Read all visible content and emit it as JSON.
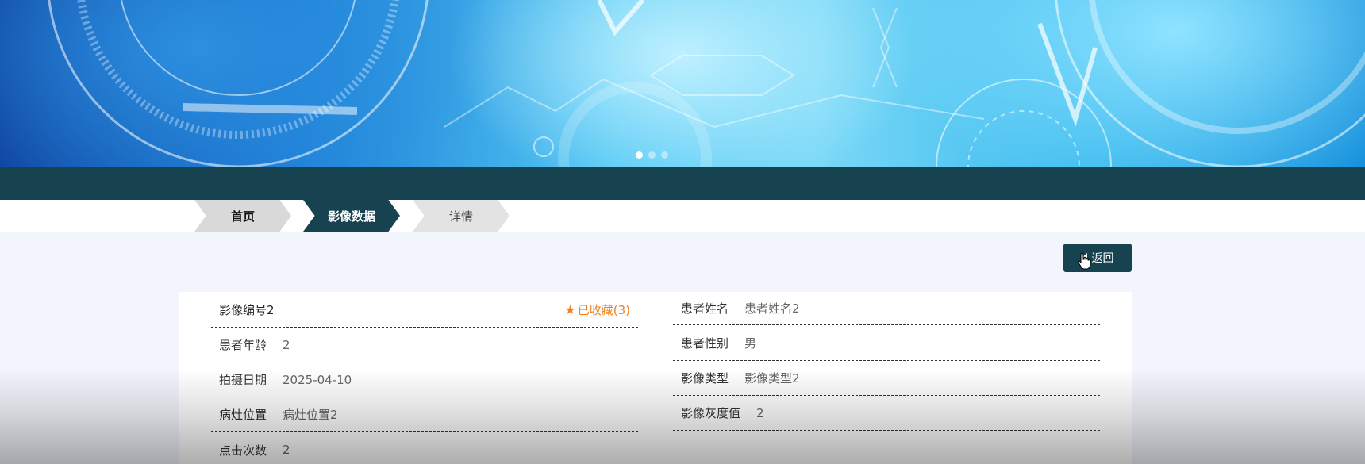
{
  "banner": {
    "carousel_active_index": 0,
    "carousel_count": 3
  },
  "breadcrumb": {
    "home": "首页",
    "section": "影像数据",
    "current": "详情"
  },
  "actions": {
    "back_label": "返回"
  },
  "detail": {
    "title": "影像编号2",
    "favorite_label": "已收藏(3)",
    "fields": {
      "patient_name_label": "患者姓名",
      "patient_name": "患者姓名2",
      "patient_age_label": "患者年龄",
      "patient_age": "2",
      "patient_gender_label": "患者性别",
      "patient_gender": "男",
      "capture_date_label": "拍摄日期",
      "capture_date": "2025-04-10",
      "image_type_label": "影像类型",
      "image_type": "影像类型2",
      "lesion_location_label": "病灶位置",
      "lesion_location": "病灶位置2",
      "image_gray_label": "影像灰度值",
      "image_gray": "2",
      "click_count_label": "点击次数",
      "click_count": "2"
    }
  },
  "colors": {
    "primary": "#17424f",
    "favorite": "#f0811c",
    "page_bg": "#f2f5fc"
  },
  "icons": {
    "favorite": "star-icon",
    "back": "back-arrow-icon",
    "cursor": "hand-cursor-icon"
  }
}
